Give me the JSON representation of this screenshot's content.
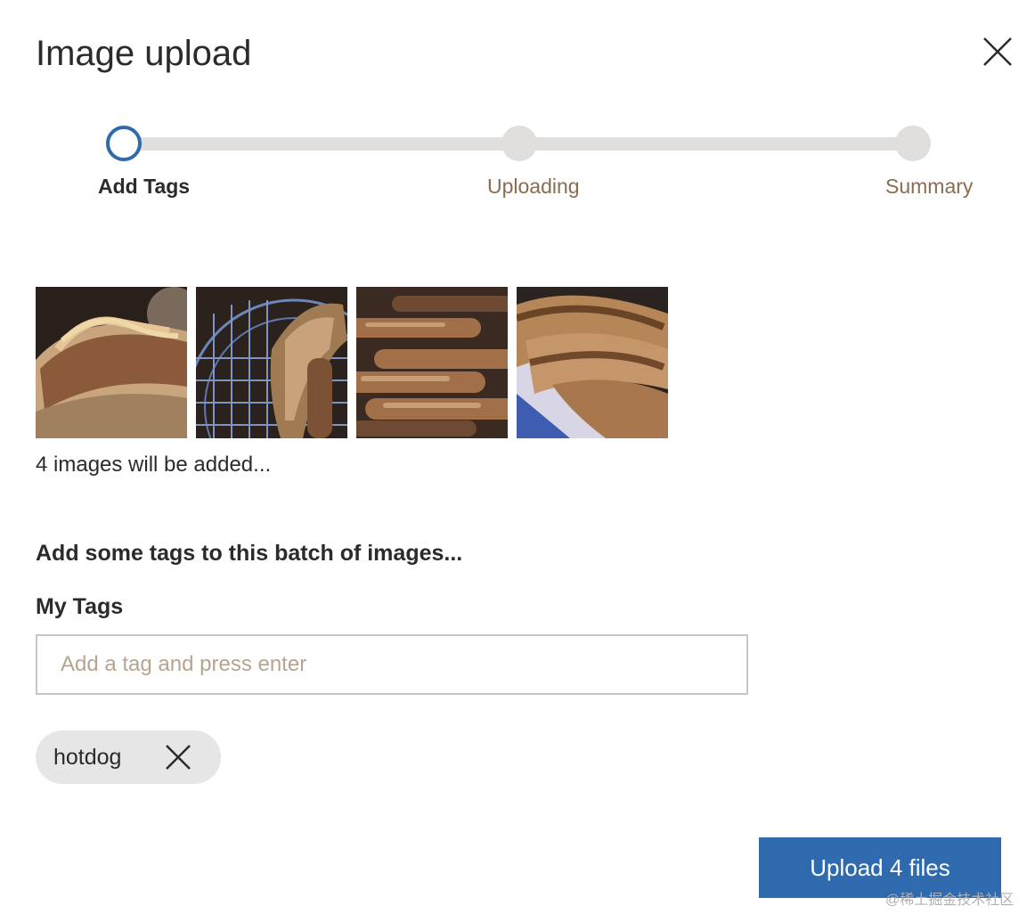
{
  "dialog": {
    "title": "Image upload",
    "close_icon": "close-icon"
  },
  "stepper": {
    "steps": [
      {
        "label": "Add Tags",
        "state": "active"
      },
      {
        "label": "Uploading",
        "state": "pending"
      },
      {
        "label": "Summary",
        "state": "pending"
      }
    ],
    "active_color": "#2f6aaf",
    "track_color": "#e1dfdd"
  },
  "images": {
    "thumbnails": [
      "hotdog-with-mustard",
      "skewer-on-grill",
      "grilled-sausages",
      "hotdogs-with-chili"
    ],
    "count_text": "4 images will be added..."
  },
  "tags": {
    "heading": "Add some tags to this batch of images...",
    "label": "My Tags",
    "input_placeholder": "Add a tag and press enter",
    "input_value": "",
    "chips": [
      {
        "label": "hotdog",
        "remove_icon": "close-icon"
      }
    ]
  },
  "actions": {
    "upload_label": "Upload 4 files",
    "primary_color": "#2f6aaf"
  },
  "watermark": "@稀土掘金技术社区"
}
